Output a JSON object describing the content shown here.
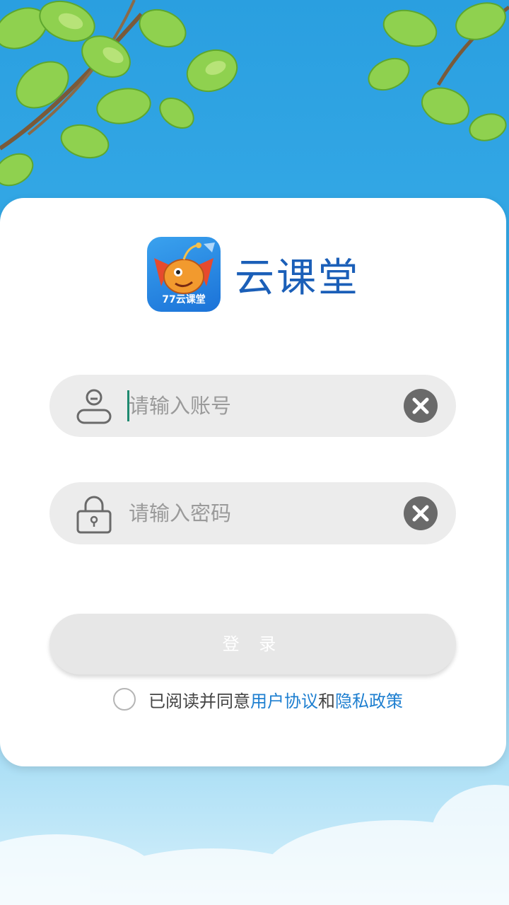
{
  "app": {
    "name": "云课堂",
    "logo_caption": "77云课堂"
  },
  "login": {
    "account_placeholder": "请输入账号",
    "password_placeholder": "请输入密码",
    "button_label": "登 录"
  },
  "agreement": {
    "prefix": "已阅读并同意",
    "user_agreement": "用户协议",
    "joiner": "和",
    "privacy_policy": "隐私政策",
    "checked": false
  },
  "icons": {
    "account": "user-icon",
    "password": "lock-icon",
    "clear": "clear-icon"
  },
  "colors": {
    "brand": "#1b5fb8",
    "link": "#1e7fd0",
    "sky": "#2a9fe0",
    "field_bg": "#ececec"
  }
}
